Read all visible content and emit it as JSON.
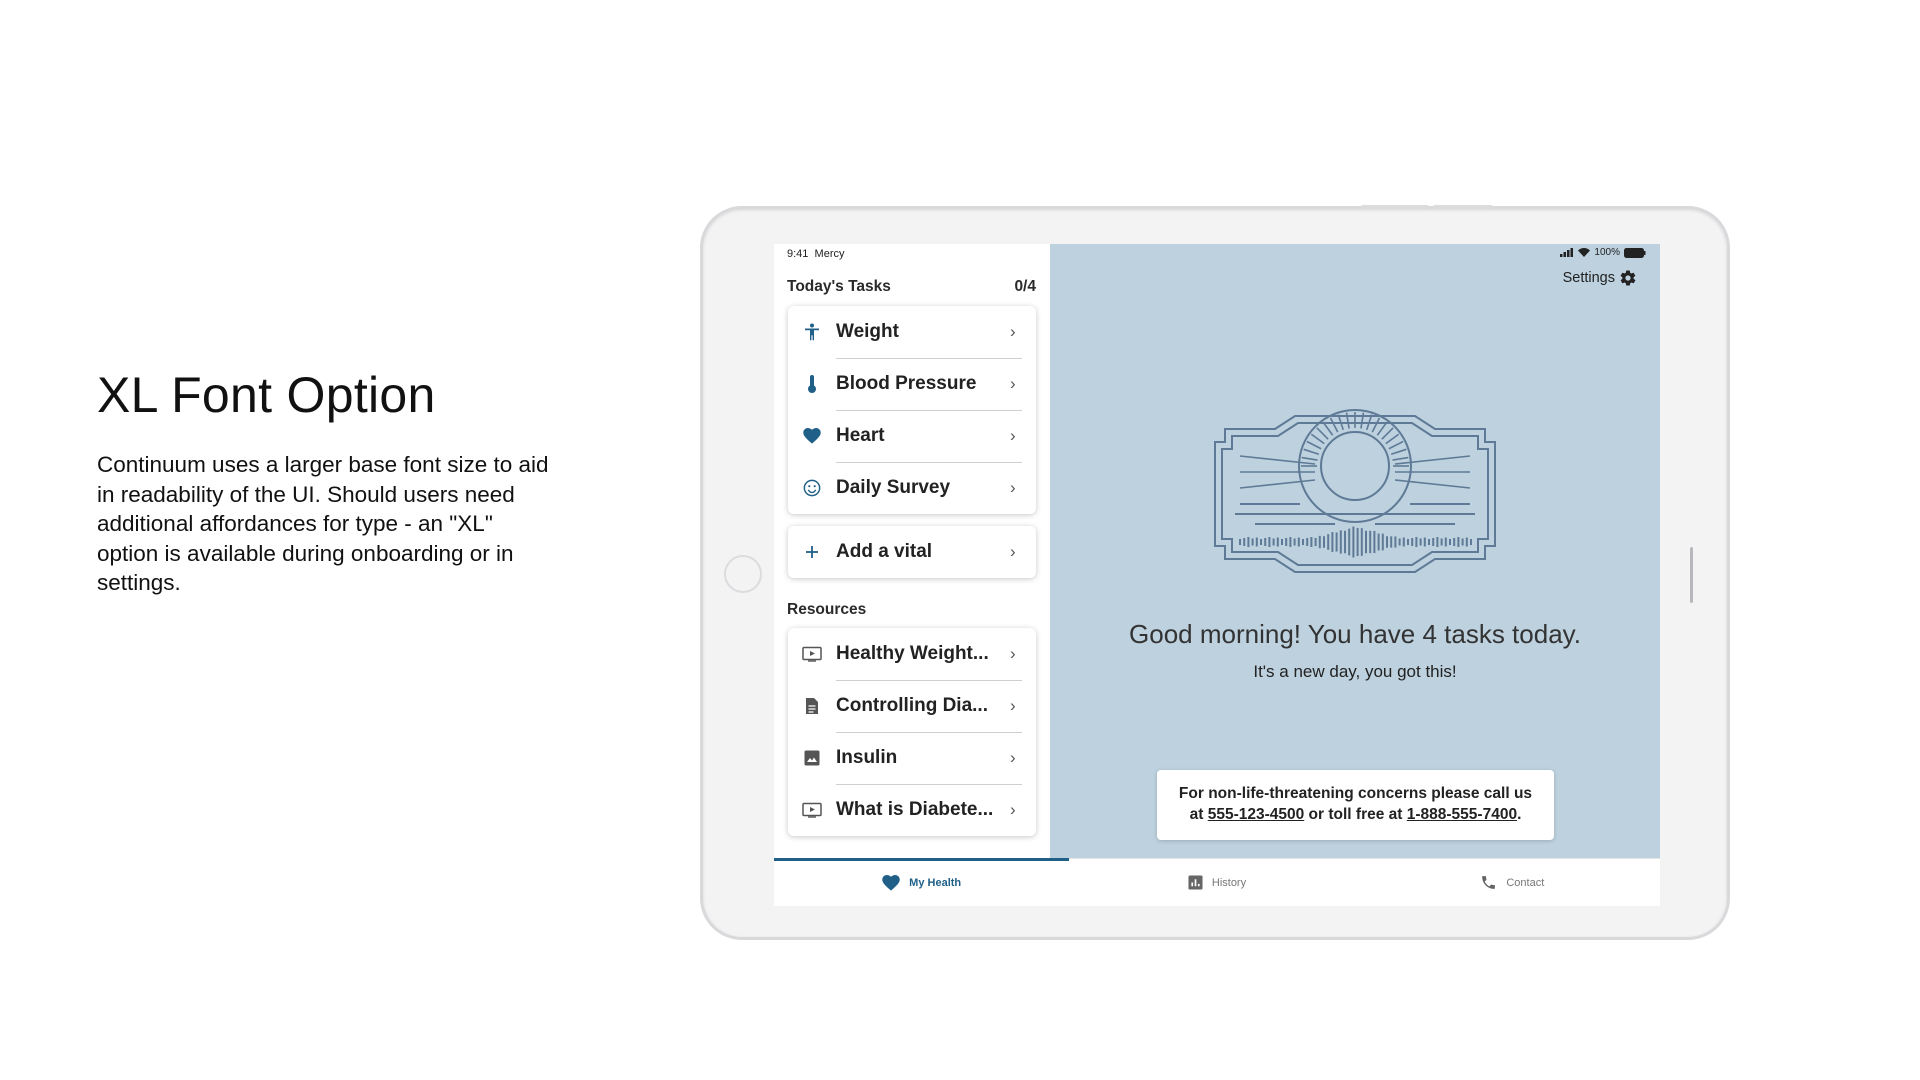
{
  "slide": {
    "title": "XL Font Option",
    "description": "Continuum uses a larger base font size to aid in readability of the UI.  Should users need additional affordances for type - an \"XL\" option is available during onboarding or in settings."
  },
  "status_bar": {
    "time": "9:41",
    "carrier": "Mercy",
    "battery": "100%"
  },
  "tasks": {
    "heading": "Today's Tasks",
    "count": "0/4",
    "items": [
      {
        "label": "Weight",
        "icon": "person-icon"
      },
      {
        "label": "Blood Pressure",
        "icon": "thermometer-icon"
      },
      {
        "label": "Heart",
        "icon": "heart-icon"
      },
      {
        "label": "Daily Survey",
        "icon": "smiley-icon"
      }
    ]
  },
  "add_vital": {
    "label": "Add a vital",
    "icon": "plus-icon"
  },
  "resources": {
    "heading": "Resources",
    "items": [
      {
        "label": "Healthy Weight...",
        "icon": "video-icon"
      },
      {
        "label": "Controlling Dia...",
        "icon": "document-icon"
      },
      {
        "label": "Insulin",
        "icon": "image-icon"
      },
      {
        "label": "What is Diabete...",
        "icon": "video-icon"
      }
    ]
  },
  "hero": {
    "settings_label": "Settings",
    "greeting": "Good morning!  You have 4 tasks today.",
    "sub_greeting": "It's a new day, you got this!",
    "contact": {
      "line1": "For non-life-threatening concerns please call us",
      "prefix": "at ",
      "phone": "555-123-4500",
      "middle": " or toll free at ",
      "tollfree": "1-888-555-7400",
      "suffix": "."
    }
  },
  "tabs": [
    {
      "label": "My Health",
      "icon": "heart-icon",
      "active": true
    },
    {
      "label": "History",
      "icon": "chart-icon",
      "active": false
    },
    {
      "label": "Contact",
      "icon": "phone-icon",
      "active": false
    }
  ],
  "colors": {
    "accent": "#1f5f88",
    "hero_bg": "#bdd1de",
    "emblem": "#5f7a96"
  }
}
